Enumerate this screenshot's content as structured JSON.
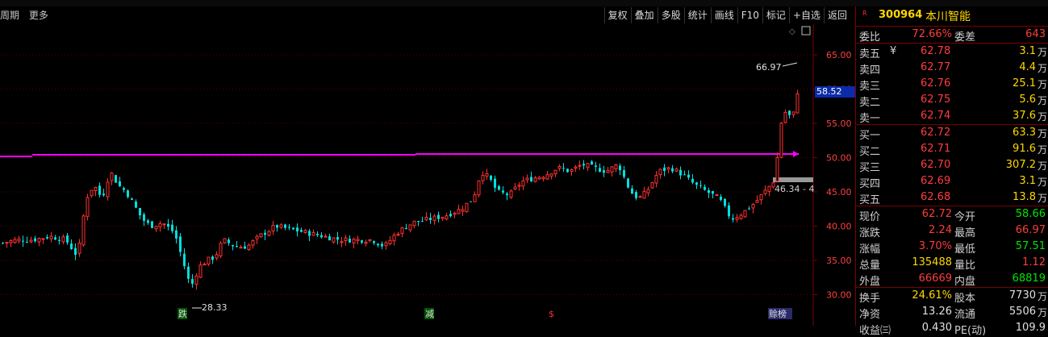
{
  "toolbar": {
    "left": [
      "周期",
      "更多"
    ],
    "buttons": [
      "复权",
      "叠加",
      "多股",
      "统计",
      "画线",
      "F10",
      "标记",
      "+自选",
      "返回"
    ]
  },
  "chart": {
    "y_ticks": [
      "65.00",
      "60.00",
      "55.00",
      "50.00",
      "45.00",
      "40.00",
      "35.00",
      "30.00"
    ],
    "current_price_tag": "58.52",
    "high_label": "66.97",
    "low_label": "28.33",
    "range_label": "46.34 - 4",
    "markers": [
      "跌",
      "减",
      "$",
      "赊榜"
    ],
    "colors": {
      "up": "#ff3030",
      "down": "#00e0e0",
      "support_line": "#ff00ff",
      "axis": "#7a0000"
    }
  },
  "quote": {
    "marker": "R",
    "code": "300964",
    "name": "本川智能",
    "weibi": {
      "label": "委比",
      "value": "72.66%",
      "label2": "委差",
      "value2": "643"
    },
    "asks": [
      {
        "label": "卖五",
        "extra": "¥",
        "price": "62.78",
        "vol": "3.1",
        "unit": "万"
      },
      {
        "label": "卖四",
        "price": "62.77",
        "vol": "4.4",
        "unit": "万"
      },
      {
        "label": "卖三",
        "price": "62.76",
        "vol": "25.1",
        "unit": "万"
      },
      {
        "label": "卖二",
        "price": "62.75",
        "vol": "5.6",
        "unit": "万"
      },
      {
        "label": "卖一",
        "price": "62.74",
        "vol": "37.6",
        "unit": "万"
      }
    ],
    "bids": [
      {
        "label": "买一",
        "price": "62.72",
        "vol": "63.3",
        "unit": "万"
      },
      {
        "label": "买二",
        "price": "62.71",
        "vol": "91.6",
        "unit": "万"
      },
      {
        "label": "买三",
        "price": "62.70",
        "vol": "307.2",
        "unit": "万"
      },
      {
        "label": "买四",
        "price": "62.69",
        "vol": "3.1",
        "unit": "万"
      },
      {
        "label": "买五",
        "price": "62.68",
        "vol": "13.8",
        "unit": "万"
      }
    ],
    "stats1": [
      {
        "l1": "现价",
        "v1": "62.72",
        "c1": "red",
        "l2": "今开",
        "v2": "58.66",
        "c2": "green"
      },
      {
        "l1": "涨跌",
        "v1": "2.24",
        "c1": "red",
        "l2": "最高",
        "v2": "66.97",
        "c2": "red"
      },
      {
        "l1": "涨幅",
        "v1": "3.70%",
        "c1": "red",
        "l2": "最低",
        "v2": "57.51",
        "c2": "green"
      },
      {
        "l1": "总量",
        "v1": "135488",
        "c1": "yellow",
        "l2": "量比",
        "v2": "1.12",
        "c2": "red"
      },
      {
        "l1": "外盘",
        "v1": "66669",
        "c1": "red",
        "l2": "内盘",
        "v2": "68819",
        "c2": "green"
      }
    ],
    "stats2": [
      {
        "l1": "换手",
        "v1": "24.61%",
        "c1": "yellow",
        "l2": "股本",
        "v2": "7730",
        "unit": "万"
      },
      {
        "l1": "净资",
        "v1": "13.26",
        "c1": "white",
        "l2": "流通",
        "v2": "5506",
        "unit": "万"
      },
      {
        "l1": "收益㈢",
        "v1": "0.430",
        "c1": "white",
        "l2": "PE(动)",
        "v2": "109.9",
        "unit": ""
      }
    ]
  }
}
